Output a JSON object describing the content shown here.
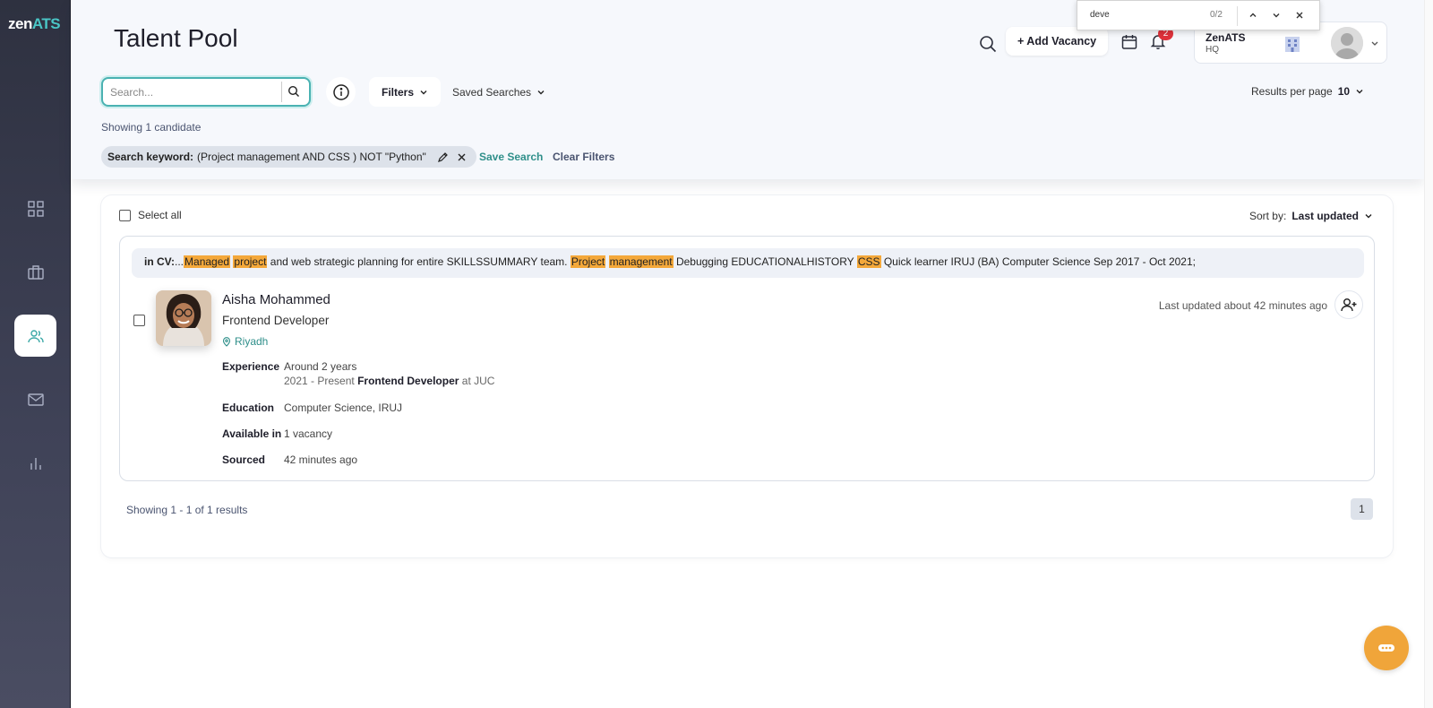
{
  "logo": {
    "zen": "zen",
    "ats": "ATS"
  },
  "sidebar": {
    "items": [
      {
        "name": "dashboard",
        "icon": "grid-icon"
      },
      {
        "name": "vacancies",
        "icon": "briefcase-icon"
      },
      {
        "name": "talent-pool",
        "icon": "users-icon",
        "active": true
      },
      {
        "name": "messages",
        "icon": "mail-icon"
      },
      {
        "name": "reports",
        "icon": "bar-chart-icon"
      }
    ]
  },
  "page": {
    "title": "Talent Pool"
  },
  "topbar": {
    "add_vacancy": "+ Add Vacancy",
    "notification_count": "2",
    "org_name": "ZenATS",
    "org_sub": "HQ"
  },
  "findbar": {
    "query": "deve",
    "count": "0/2"
  },
  "search": {
    "placeholder": "Search...",
    "value": ""
  },
  "filters": {
    "label": "Filters",
    "saved_searches": "Saved Searches"
  },
  "results_per_page": {
    "label": "Results per page",
    "value": "10"
  },
  "showing_candidates": "Showing 1 candidate",
  "active_filter": {
    "label": "Search keyword:",
    "value": "(Project management AND CSS ) NOT \"Python\""
  },
  "save_search": "Save Search",
  "clear_filters": "Clear Filters",
  "list": {
    "select_all": "Select all",
    "sort_label": "Sort by:",
    "sort_value": "Last updated"
  },
  "candidate": {
    "cv_label": "in CV:",
    "cv_parts": [
      {
        "text": "...",
        "hl": false
      },
      {
        "text": "Managed",
        "hl": true
      },
      {
        "text": " ",
        "hl": false
      },
      {
        "text": "project",
        "hl": true
      },
      {
        "text": " and web strategic planning for entire SKILLSSUMMARY team. ",
        "hl": false
      },
      {
        "text": "Project",
        "hl": true
      },
      {
        "text": " ",
        "hl": false
      },
      {
        "text": "management",
        "hl": true
      },
      {
        "text": " Debugging EDUCATIONALHISTORY ",
        "hl": false
      },
      {
        "text": "CSS",
        "hl": true
      },
      {
        "text": " Quick learner IRUJ (BA) Computer Science Sep 2017 - Oct 2021;",
        "hl": false
      }
    ],
    "name": "Aisha Mohammed",
    "role": "Frontend Developer",
    "location": "Riyadh",
    "last_updated": "Last updated about 42 minutes ago",
    "experience_label": "Experience",
    "experience_value": "Around 2 years",
    "experience_period": "2021 - Present",
    "experience_title": "Frontend Developer",
    "experience_at": "at JUC",
    "education_label": "Education",
    "education_value": "Computer Science, IRUJ",
    "available_label": "Available in",
    "available_value": "1 vacancy",
    "sourced_label": "Sourced",
    "sourced_value": "42 minutes ago"
  },
  "pagination": {
    "summary": "Showing 1 - 1 of 1 results",
    "current": "1"
  },
  "colors": {
    "accent": "#2f8f8a",
    "highlight": "#f4a83a",
    "fab": "#f0a53a",
    "badge": "#e0323b"
  }
}
